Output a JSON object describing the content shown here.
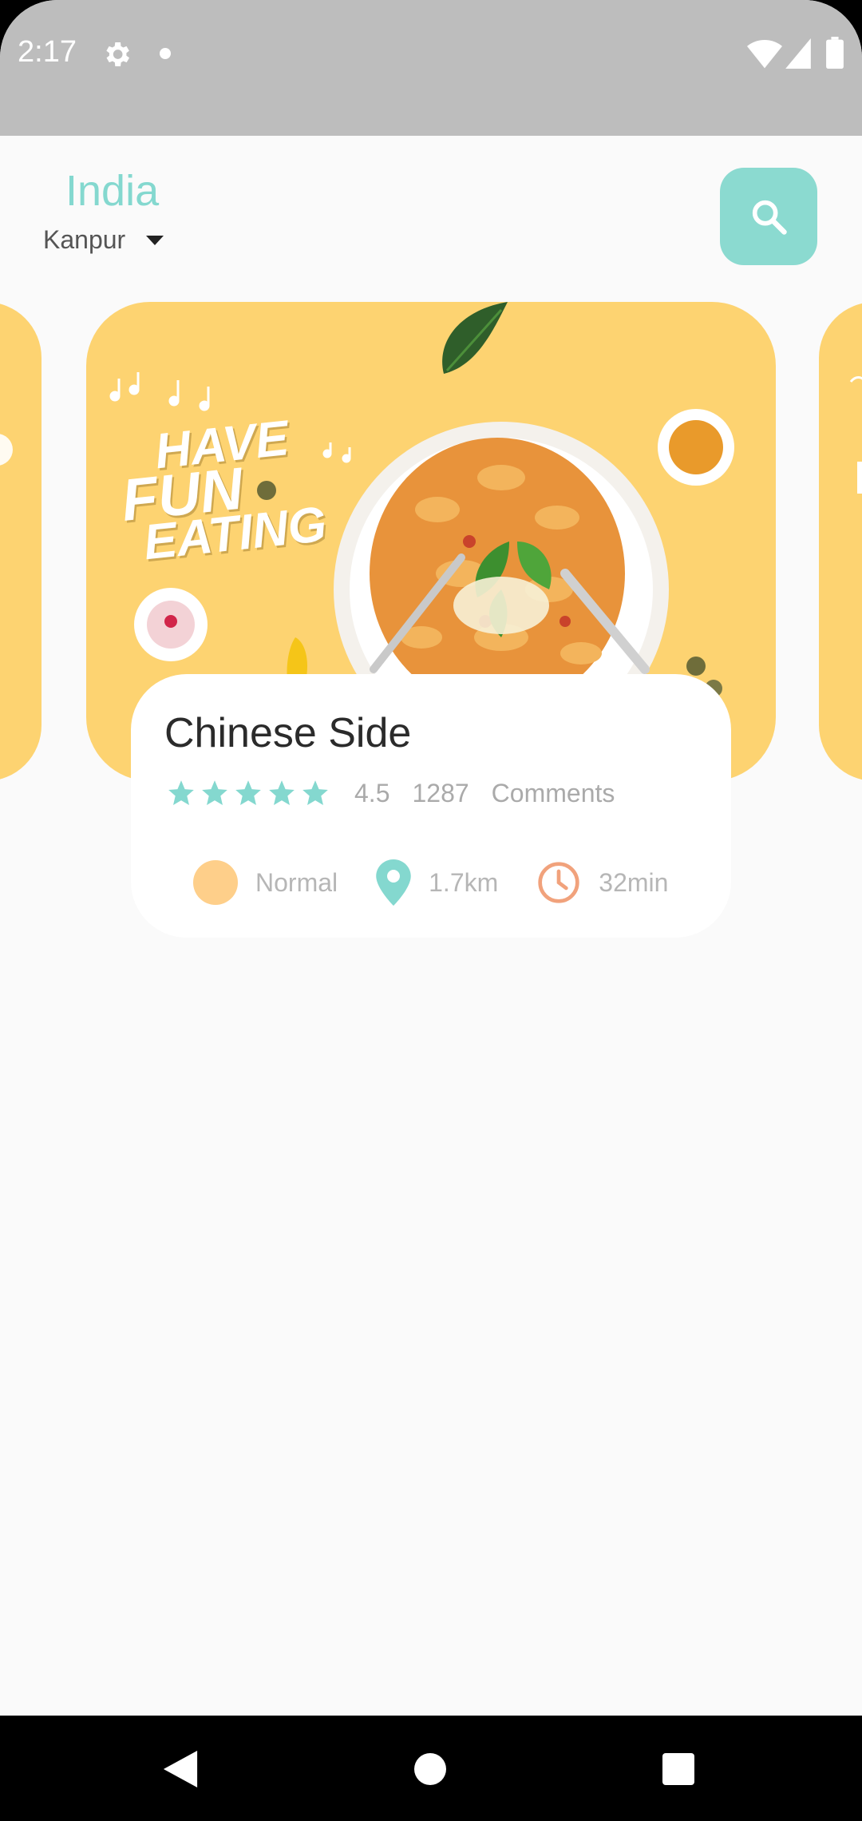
{
  "status_bar": {
    "time": "2:17"
  },
  "header": {
    "country": "India",
    "city": "Kanpur"
  },
  "banner": {
    "line1": "HAVE",
    "line2": "FUN",
    "line3": "EATING"
  },
  "restaurant": {
    "title": "Chinese Side",
    "rating": "4.5",
    "rating_stars": 5,
    "comment_count": "1287",
    "comment_label": "Comments",
    "level": "Normal",
    "distance": "1.7km",
    "time": "32min"
  },
  "colors": {
    "accent": "#84d8cf",
    "card_yellow": "#fdd371",
    "level_dot": "#fecf8a",
    "clock": "#f1a27c"
  }
}
